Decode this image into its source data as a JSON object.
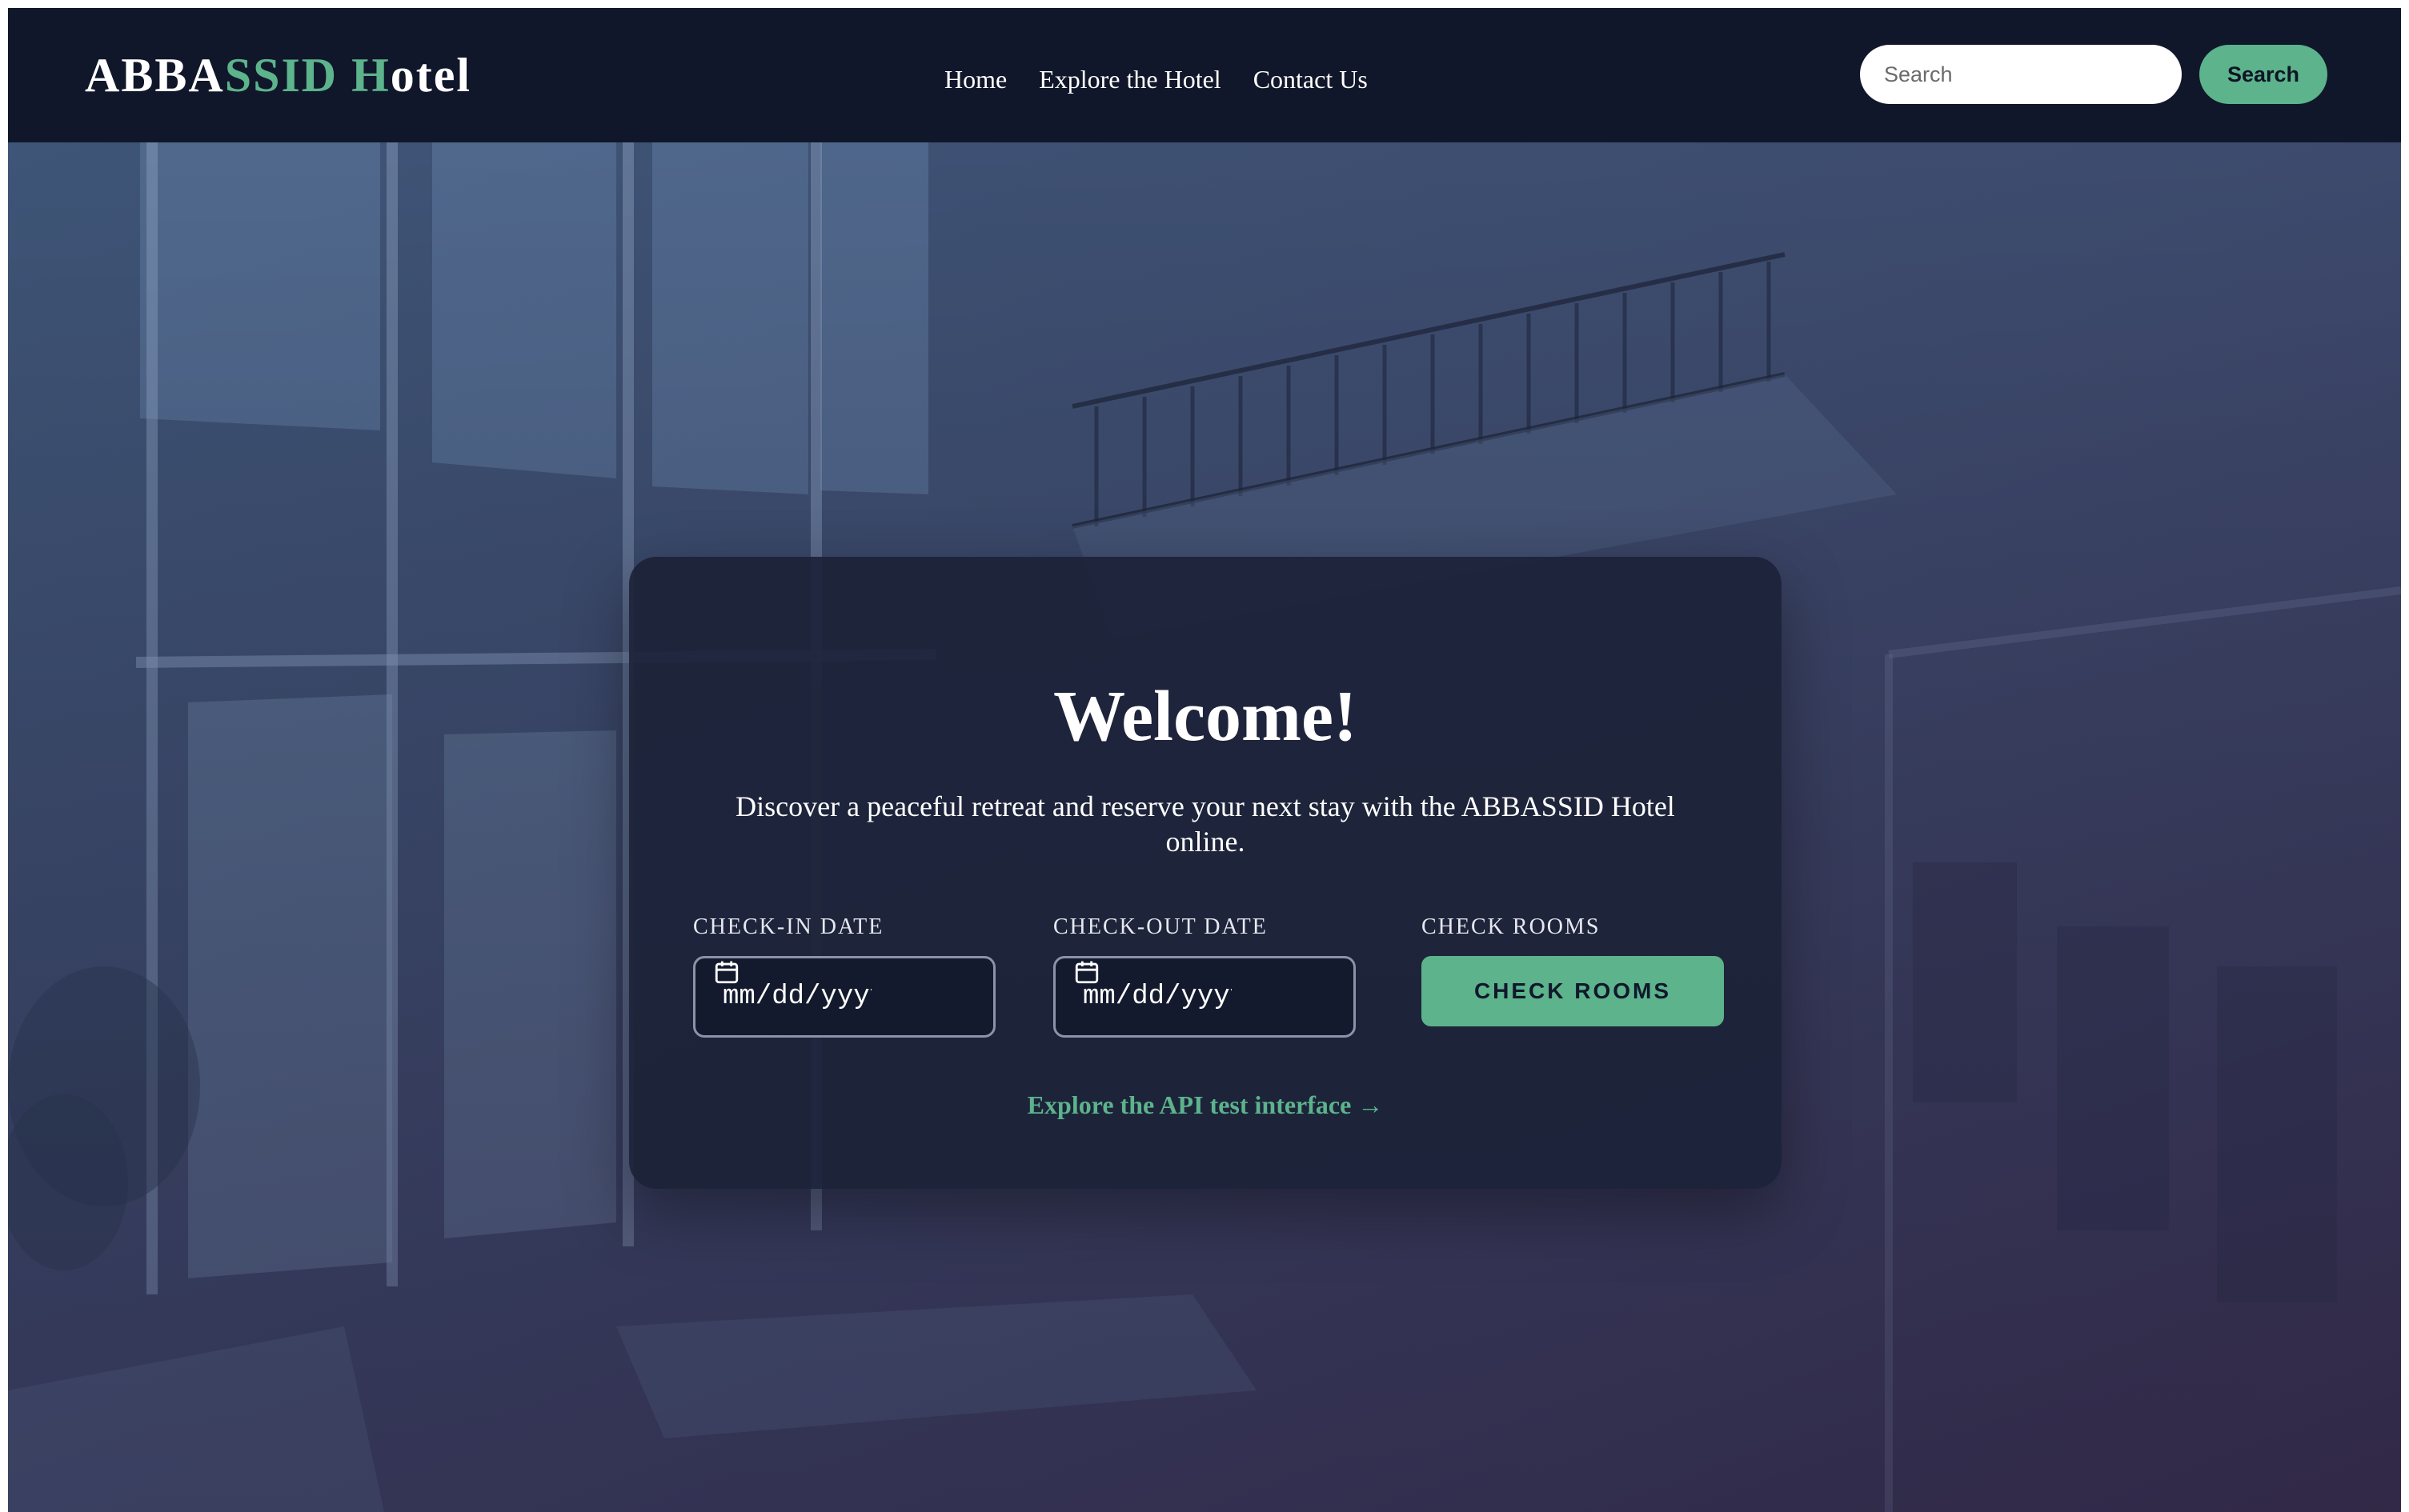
{
  "navbar": {
    "brand_part1": "ABBA",
    "brand_part2": "SSID",
    "brand_space": " ",
    "brand_part3": "H",
    "brand_part4": "otel",
    "links": [
      "Home",
      "Explore the Hotel",
      "Contact Us"
    ],
    "search_placeholder": "Search",
    "search_button": "Search"
  },
  "hero": {
    "title": "Welcome!",
    "subtitle": "Discover a peaceful retreat and reserve your next stay with the ABBASSID Hotel online.",
    "checkin_label": "CHECK-IN DATE",
    "checkin_value": "mm/dd/yyyy",
    "checkout_label": "CHECK-OUT DATE",
    "checkout_value": "mm/dd/yyyy",
    "rooms_label": "CHECK ROOMS",
    "rooms_button": "CHECK ROOMS",
    "api_link": "Explore the API test interface →"
  },
  "colors": {
    "navbar_bg": "#11172a",
    "accent": "#5cb38c",
    "card_bg": "#1c2238"
  },
  "icons": {
    "calendar": "calendar-icon"
  }
}
